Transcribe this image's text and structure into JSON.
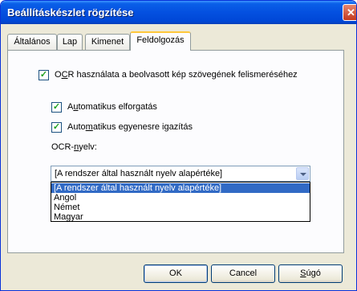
{
  "window": {
    "title": "Beállításkészlet rögzítése",
    "close_glyph": "✕"
  },
  "tabs": [
    {
      "label": "Általános"
    },
    {
      "label": "Lap"
    },
    {
      "label": "Kimenet"
    },
    {
      "label": "Feldolgozás",
      "active": true
    }
  ],
  "panel": {
    "ocr_checkbox": {
      "label_pre": "O",
      "label_u": "C",
      "label_post": "R használata a beolvasott kép szövegének felismeréséhez",
      "checked": true
    },
    "auto_rotate": {
      "label_pre": "A",
      "label_u": "u",
      "label_post": "tomatikus elforgatás",
      "checked": true
    },
    "auto_straighten": {
      "label_pre": "Auto",
      "label_u": "m",
      "label_post": "atikus egyenesre igazítás",
      "checked": true
    },
    "language_label": {
      "pre": "OCR-",
      "u": "n",
      "post": "yelv:"
    },
    "language_combo": {
      "value": "[A rendszer által használt nyelv alapértéke]",
      "options": [
        "[A rendszer által használt nyelv alapértéke]",
        "Angol",
        "Német",
        "Magyar"
      ],
      "selected_index": 0
    }
  },
  "buttons": {
    "ok": "OK",
    "cancel": "Cancel",
    "help_pre": "",
    "help_u": "S",
    "help_post": "úgó"
  },
  "check_glyph": "✓",
  "colors": {
    "titlebar": "#0450e0",
    "selection": "#316ac5",
    "check": "#21a121"
  }
}
